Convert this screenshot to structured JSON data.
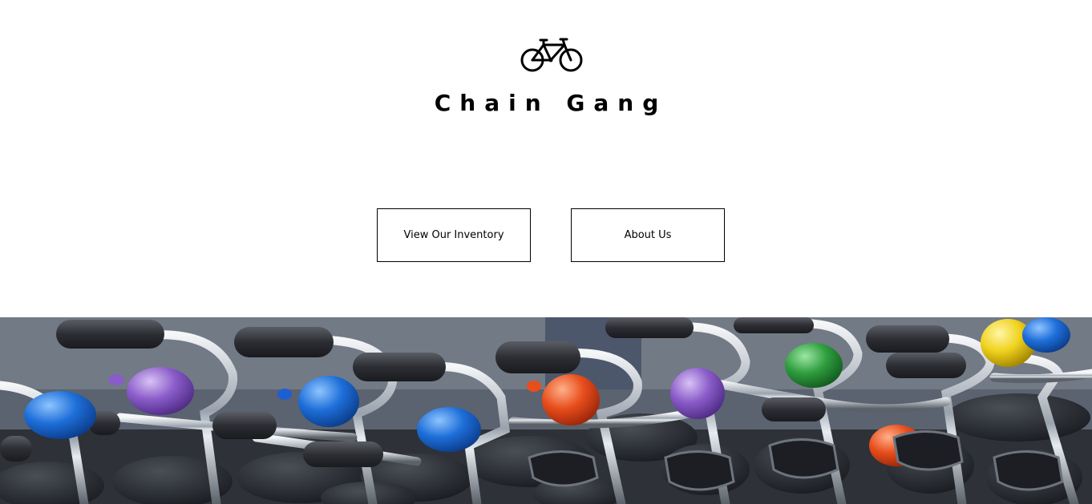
{
  "brand": {
    "logo_icon": "bicycle-icon",
    "title": "Chain Gang"
  },
  "nav": {
    "inventory_label": "View Our Inventory",
    "about_label": "About Us"
  },
  "hero": {
    "image": "row-of-bicycles-with-colorful-bells"
  },
  "colors": {
    "background": "#ffffff",
    "text": "#000000",
    "bell_colors": [
      "#1e6fd9",
      "#8a5cc9",
      "#1d5fd1",
      "#2a7be0",
      "#e84e1c",
      "#9a6ad0",
      "#2f9e3f",
      "#e8451a",
      "#f0d21e",
      "#2b73d6"
    ]
  }
}
